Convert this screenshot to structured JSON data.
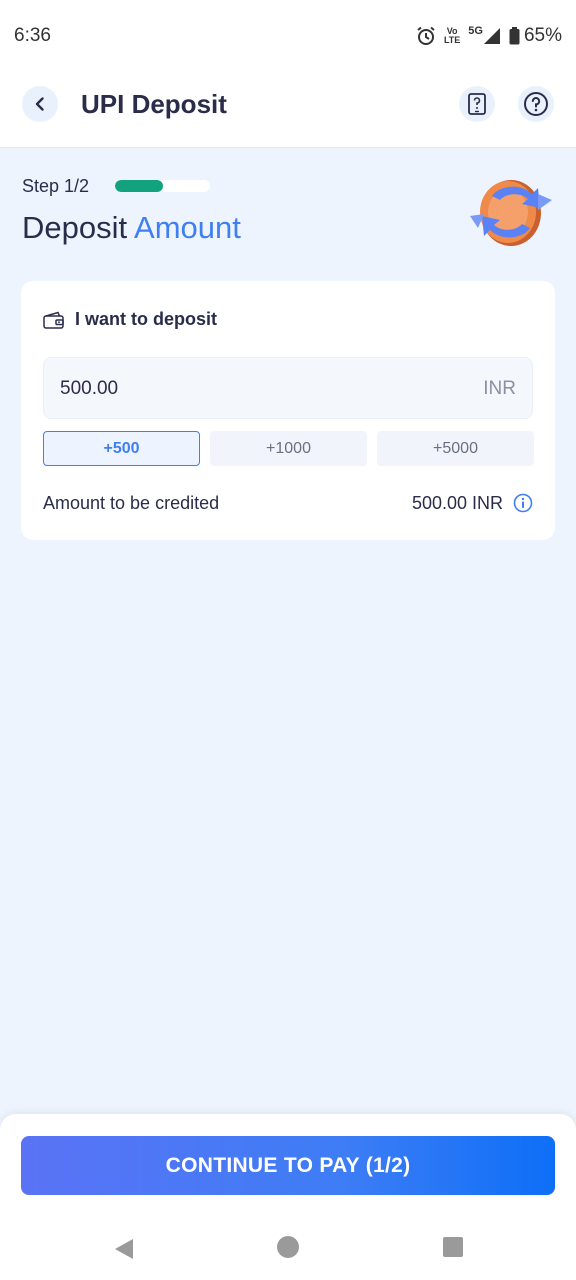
{
  "status_bar": {
    "time": "6:36",
    "network_top": "Vo",
    "network_bottom": "LTE",
    "network_type": "5G",
    "battery": "65%",
    "icons": [
      "alarm-icon",
      "volte-icon",
      "signal-icon",
      "battery-icon"
    ]
  },
  "header": {
    "title": "UPI Deposit",
    "icons": [
      "back-arrow-icon",
      "phone-help-icon",
      "help-circle-icon"
    ]
  },
  "step": {
    "label": "Step 1/2",
    "progress_fraction": 0.5,
    "heading_primary": "Deposit",
    "heading_accent": "Amount"
  },
  "deposit_card": {
    "title": "I want to deposit",
    "icon": "wallet-icon",
    "amount_value": "500.00",
    "currency": "INR",
    "quick_amounts": [
      "+500",
      "+1000",
      "+5000"
    ],
    "selected_quick_amount": "+500",
    "credited_label": "Amount to be credited",
    "credited_value": "500.00 INR"
  },
  "cta": {
    "label": "CONTINUE TO PAY (1/2)"
  },
  "colors": {
    "accent": "#3f7ff1",
    "progress": "#12a37e",
    "background": "#eef4fe"
  }
}
